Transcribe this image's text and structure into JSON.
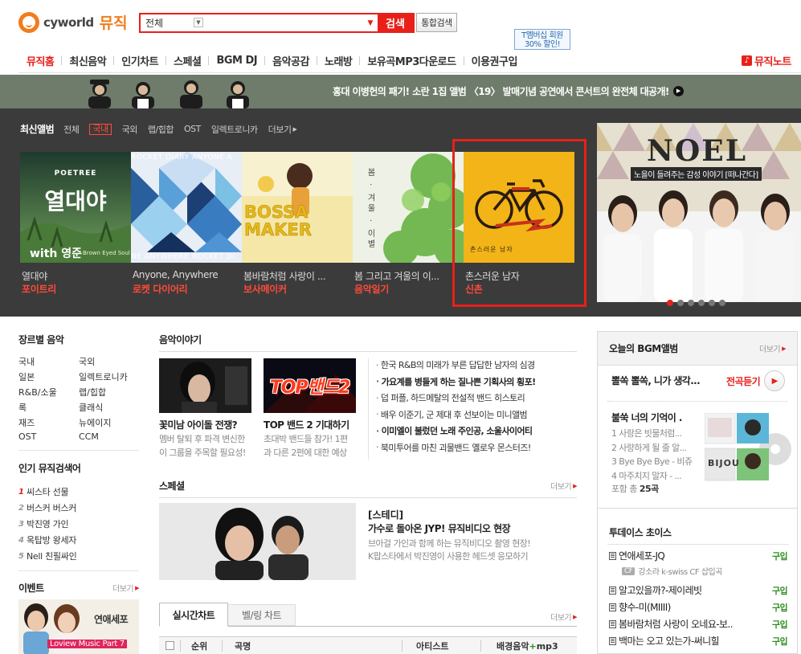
{
  "header": {
    "logo_word": "cyworld",
    "logo_music": "뮤직",
    "search": {
      "category": "전체",
      "placeholder": "",
      "button": "검색",
      "unified_button": "통합검색"
    },
    "tmember": {
      "line1": "T멤버십 회원",
      "line2": "30% 할인!"
    },
    "nav": [
      "뮤직홈",
      "최신음악",
      "인기차트",
      "스페셜",
      "BGM DJ",
      "음악공감",
      "노래방",
      "보유곡MP3다운로드",
      "이용권구입"
    ],
    "music_note": "뮤직노트"
  },
  "banner": {
    "text": "홍대 이병헌의 패기! 소란 1집 앨범 〈19〉 발매기념 공연에서 콘서트의 완전체 대공개!"
  },
  "albums": {
    "title": "최신앨범",
    "tabs": [
      "전체",
      "국내",
      "국외",
      "랩/힙합",
      "OST",
      "일렉트로니카"
    ],
    "active_tab": "국내",
    "more": "더보기",
    "items": [
      {
        "name": "열대야",
        "artist": "포이트리",
        "cover_title": "열대야",
        "cover_top": "POETREE",
        "cover_bottom": "with 영준",
        "cover_sub": "Brown Eyed Soul"
      },
      {
        "name": "Anyone, Anywhere",
        "artist": "로켓 다이어리",
        "cover_top": "ROCKET DIARY ANYONE A",
        "cover_bottom": "NE ANYWHERE ROCKET DI"
      },
      {
        "name": "봄바람처럼 사랑이 ...",
        "artist": "보사메이커",
        "cover_title": "BOSSA MAKER"
      },
      {
        "name": "봄 그리고 겨울의 이...",
        "artist": "음악일기",
        "cover_title": "봄 · 겨울 · 이별"
      },
      {
        "name": "촌스러운 남자",
        "artist": "신촌",
        "cover_sub": "촌스러운 남자"
      }
    ],
    "promo": {
      "title": "NOEL",
      "subtitle": "노을이 들려주는 감성 이야기 [떠나간다]"
    }
  },
  "genre": {
    "title": "장르별 음악",
    "items": [
      "국내",
      "국외",
      "일본",
      "일렉트로니카",
      "R&B/소울",
      "랩/힙합",
      "록",
      "클래식",
      "재즈",
      "뉴에이지",
      "OST",
      "CCM"
    ]
  },
  "popular": {
    "title": "인기 뮤직검색어",
    "items": [
      {
        "rank": "1",
        "text": "씨스타 선물"
      },
      {
        "rank": "2",
        "text": "버스커 버스커"
      },
      {
        "rank": "3",
        "text": "박진영 가인"
      },
      {
        "rank": "4",
        "text": "옥탑방 왕세자"
      },
      {
        "rank": "5",
        "text": "Nell 친필싸인"
      }
    ]
  },
  "event": {
    "title": "이벤트",
    "more": "더보기",
    "caption": "연애세포",
    "sub": "Loview Music Part 7"
  },
  "story": {
    "title": "음악이야기",
    "cards": [
      {
        "title": "꽃미남 아이돌 전쟁?",
        "desc1": "멤버 탈퇴 후 파격 변신한",
        "desc2": "이 그룹을 주목할 필요성!"
      },
      {
        "title": "TOP 밴드 2 기대하기",
        "desc1": "초대박 밴드들 참가! 1편",
        "desc2": "과 다른 2편에 대한 예상",
        "img_text": "TOP밴드2"
      }
    ],
    "list": [
      {
        "text": "한국 R&B의 미래가 부른 답답한 남자의 심경",
        "bold": false
      },
      {
        "text": "가요계를 병들게 하는 질나쁜 기획사의 횡포!",
        "bold": true
      },
      {
        "text": "덥 퍼플, 하드메탈의 전설적 밴드 히스토리",
        "bold": false
      },
      {
        "text": "배우 이준기, 군 제대 후 선보이는 미니앨범",
        "bold": false
      },
      {
        "text": "이미엘이 불렀던 노래 주인공, 소울사이어티",
        "bold": true
      },
      {
        "text": "북미투어를 마친 괴물밴드 옐로우 몬스터즈!",
        "bold": false
      }
    ]
  },
  "special": {
    "title": "스페셜",
    "more": "더보기",
    "title1": "[스테디]",
    "title2": "가수로 돌아온 JYP! 뮤직비디오 현장",
    "desc1": "브아걸 가인과 함께 하는 뮤직비디오 촬영 현장!",
    "desc2": "K팝스타에서 박진영이 사용한 헤드셋 응모하기"
  },
  "chart": {
    "tabs": [
      "실시간차트",
      "벨/링 차트"
    ],
    "more": "더보기",
    "columns": [
      "순위",
      "곡명",
      "아티스트",
      "배경음악",
      "mp3"
    ]
  },
  "bgm": {
    "title": "오늘의 BGM앨범",
    "more": "더보기",
    "feature": "뽈쏙 뽈쏙, 니가 생각...",
    "listen": "전곡듣기",
    "album_title": "불쑥 너의 기억이 .",
    "tracks": [
      "1 사랑은 빗물처럼...",
      "2 사랑하게 될 줄 알...",
      "3 Bye Bye Bye - 비쥬",
      "4 마주치지 말자 - ..."
    ],
    "total_prefix": "포함 총 ",
    "total_count": "25곡",
    "art_text": "BIJOU"
  },
  "choice": {
    "title": "투데이스 초이스",
    "items": [
      "연애세포-JQ",
      "알고있을까?-제이레빗",
      "향수-미(MIIII)",
      "봄바람처럼 사랑이 오네요-보..",
      "백마는 오고 있는가-써니힐"
    ],
    "buy": "구입",
    "sub_badge": "CF",
    "sub_text": "강소라 k-swiss CF 삽입곡"
  },
  "colors": {
    "accent": "#e8201a",
    "brand_orange": "#f27c1a",
    "dark_bg": "#3b3b3b",
    "buy_green": "#2f8f22"
  }
}
